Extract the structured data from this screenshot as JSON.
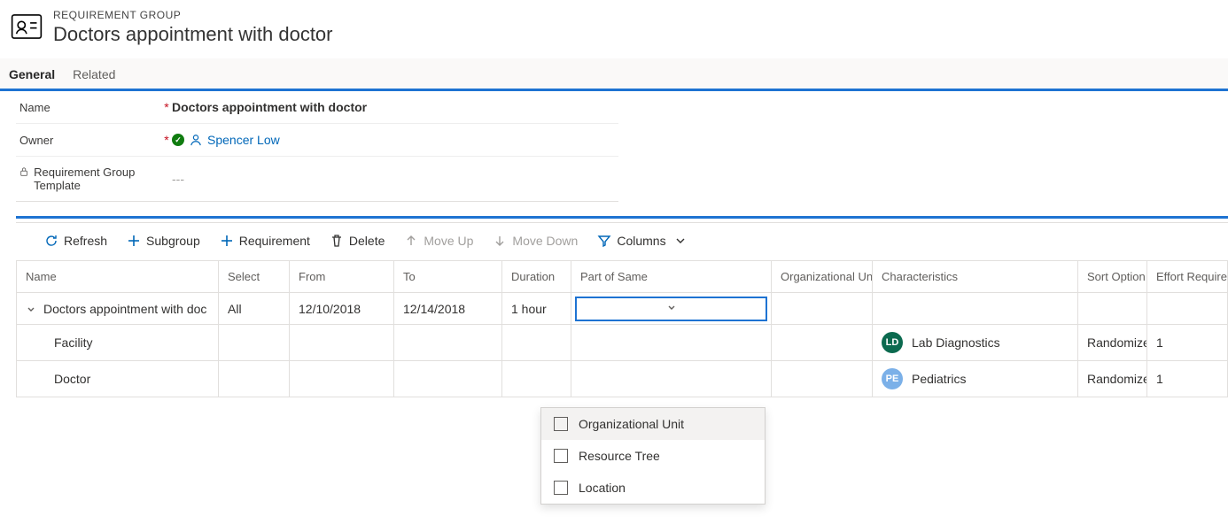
{
  "header": {
    "entity_label": "REQUIREMENT GROUP",
    "title": "Doctors appointment with doctor"
  },
  "tabs": [
    {
      "label": "General",
      "active": true
    },
    {
      "label": "Related",
      "active": false
    }
  ],
  "form": {
    "name_label": "Name",
    "name_value": "Doctors appointment with doctor",
    "owner_label": "Owner",
    "owner_value": "Spencer Low",
    "template_label": "Requirement Group Template",
    "template_value": "---"
  },
  "toolbar": {
    "refresh": "Refresh",
    "subgroup": "Subgroup",
    "requirement": "Requirement",
    "delete": "Delete",
    "move_up": "Move Up",
    "move_down": "Move Down",
    "columns": "Columns"
  },
  "grid": {
    "headers": {
      "name": "Name",
      "select": "Select",
      "from": "From",
      "to": "To",
      "duration": "Duration",
      "part": "Part of Same",
      "org": "Organizational Unit",
      "char": "Characteristics",
      "sort": "Sort Option",
      "effort": "Effort Require"
    },
    "rows": [
      {
        "level": 0,
        "name": "Doctors appointment with doc",
        "select": "All",
        "from": "12/10/2018",
        "to": "12/14/2018",
        "duration": "1 hour",
        "part_editing": true,
        "org": "",
        "char": {
          "badge": "",
          "text": ""
        },
        "sort": "",
        "effort": ""
      },
      {
        "level": 1,
        "name": "Facility",
        "select": "",
        "from": "",
        "to": "",
        "duration": "",
        "part": "",
        "org": "",
        "char": {
          "badge": "LD",
          "badge_class": "ld",
          "text": "Lab Diagnostics"
        },
        "sort": "Randomize",
        "effort": "1"
      },
      {
        "level": 1,
        "name": "Doctor",
        "select": "",
        "from": "",
        "to": "",
        "duration": "",
        "part": "",
        "org": "",
        "char": {
          "badge": "PE",
          "badge_class": "pe",
          "text": "Pediatrics"
        },
        "sort": "Randomize",
        "effort": "1"
      }
    ]
  },
  "popup": {
    "items": [
      "Organizational Unit",
      "Resource Tree",
      "Location"
    ]
  }
}
